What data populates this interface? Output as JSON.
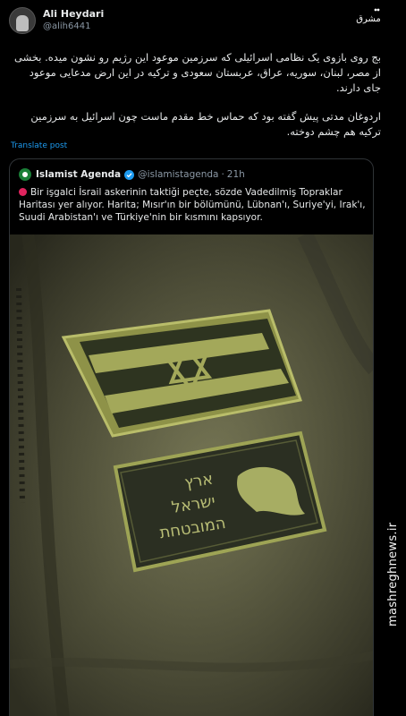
{
  "post": {
    "display_name": "Ali Heydari",
    "handle": "@alih6441",
    "text_paragraph_1": "بج روی بازوی یک نظامی اسرائیلی که سرزمین موعود این رژیم رو نشون میده. بخشی از مصر، لبنان، سوریه، عراق، عربستان سعودی و ترکیه در این ارض مدعایی موعود جای دارند.",
    "text_paragraph_2": "اردوغان مدتی پیش گفته بود که حماس خط مقدم ماست چون اسرائیل به سرزمین ترکیه هم چشم دوخته.",
    "translate_label": "Translate post"
  },
  "quoted": {
    "display_name": "Islamist Agenda",
    "handle": "@islamistagenda",
    "separator": "·",
    "time": "21h",
    "text": "Bir işgalci İsrail askerinin taktiği peçte, sözde Vadedilmiş Topraklar Haritası yer alıyor. Harita; Mısır'ın bir bölümünü, Lübnan'ı, Suriye'yi, Irak'ı, Suudi Arabistan'ı ve Türkiye'nin bir kısmını kapsıyor."
  },
  "patch": {
    "line1": "ארץ",
    "line2": "ישראל",
    "line3": "המובטחת"
  },
  "watermark": {
    "side_text": "mashreghnews.ir",
    "logo_text": "مشرق"
  },
  "colors": {
    "background": "#000000",
    "link": "#1d9bf0",
    "verified": "#1d9bf0",
    "fabric": "#6b6b4a",
    "patch": "#9ea455"
  }
}
